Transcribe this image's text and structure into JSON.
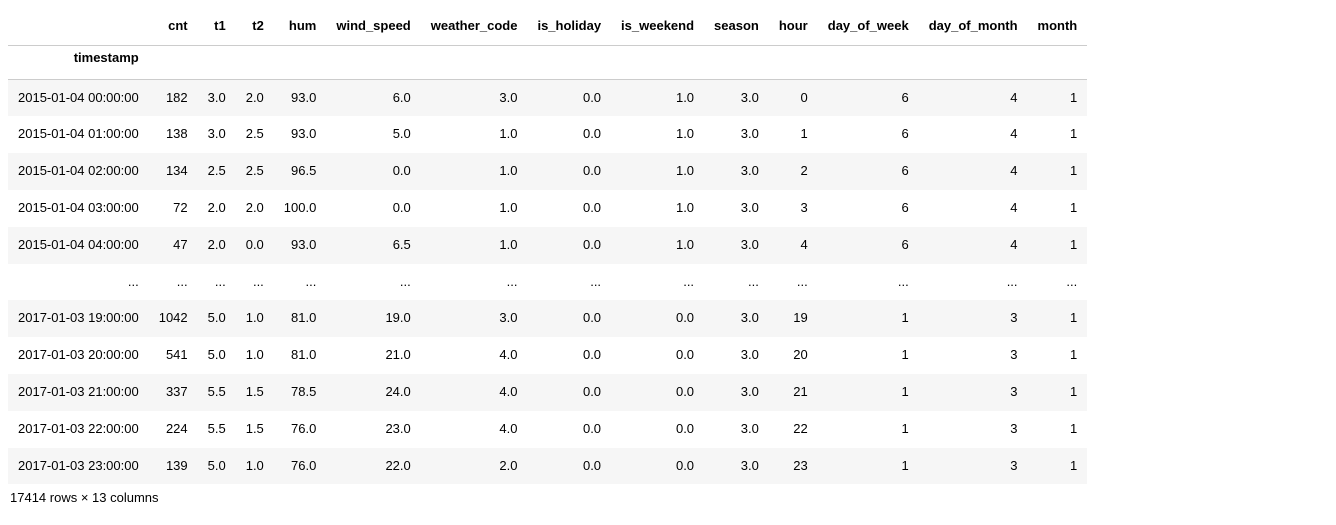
{
  "table": {
    "index_name": "timestamp",
    "columns": [
      "cnt",
      "t1",
      "t2",
      "hum",
      "wind_speed",
      "weather_code",
      "is_holiday",
      "is_weekend",
      "season",
      "hour",
      "day_of_week",
      "day_of_month",
      "month"
    ],
    "rows": [
      {
        "idx": "2015-01-04 00:00:00",
        "cells": [
          "182",
          "3.0",
          "2.0",
          "93.0",
          "6.0",
          "3.0",
          "0.0",
          "1.0",
          "3.0",
          "0",
          "6",
          "4",
          "1"
        ]
      },
      {
        "idx": "2015-01-04 01:00:00",
        "cells": [
          "138",
          "3.0",
          "2.5",
          "93.0",
          "5.0",
          "1.0",
          "0.0",
          "1.0",
          "3.0",
          "1",
          "6",
          "4",
          "1"
        ]
      },
      {
        "idx": "2015-01-04 02:00:00",
        "cells": [
          "134",
          "2.5",
          "2.5",
          "96.5",
          "0.0",
          "1.0",
          "0.0",
          "1.0",
          "3.0",
          "2",
          "6",
          "4",
          "1"
        ]
      },
      {
        "idx": "2015-01-04 03:00:00",
        "cells": [
          "72",
          "2.0",
          "2.0",
          "100.0",
          "0.0",
          "1.0",
          "0.0",
          "1.0",
          "3.0",
          "3",
          "6",
          "4",
          "1"
        ]
      },
      {
        "idx": "2015-01-04 04:00:00",
        "cells": [
          "47",
          "2.0",
          "0.0",
          "93.0",
          "6.5",
          "1.0",
          "0.0",
          "1.0",
          "3.0",
          "4",
          "6",
          "4",
          "1"
        ]
      },
      {
        "idx": "...",
        "cells": [
          "...",
          "...",
          "...",
          "...",
          "...",
          "...",
          "...",
          "...",
          "...",
          "...",
          "...",
          "...",
          "..."
        ],
        "ellipsis": true
      },
      {
        "idx": "2017-01-03 19:00:00",
        "cells": [
          "1042",
          "5.0",
          "1.0",
          "81.0",
          "19.0",
          "3.0",
          "0.0",
          "0.0",
          "3.0",
          "19",
          "1",
          "3",
          "1"
        ]
      },
      {
        "idx": "2017-01-03 20:00:00",
        "cells": [
          "541",
          "5.0",
          "1.0",
          "81.0",
          "21.0",
          "4.0",
          "0.0",
          "0.0",
          "3.0",
          "20",
          "1",
          "3",
          "1"
        ]
      },
      {
        "idx": "2017-01-03 21:00:00",
        "cells": [
          "337",
          "5.5",
          "1.5",
          "78.5",
          "24.0",
          "4.0",
          "0.0",
          "0.0",
          "3.0",
          "21",
          "1",
          "3",
          "1"
        ]
      },
      {
        "idx": "2017-01-03 22:00:00",
        "cells": [
          "224",
          "5.5",
          "1.5",
          "76.0",
          "23.0",
          "4.0",
          "0.0",
          "0.0",
          "3.0",
          "22",
          "1",
          "3",
          "1"
        ]
      },
      {
        "idx": "2017-01-03 23:00:00",
        "cells": [
          "139",
          "5.0",
          "1.0",
          "76.0",
          "22.0",
          "2.0",
          "0.0",
          "0.0",
          "3.0",
          "23",
          "1",
          "3",
          "1"
        ]
      }
    ],
    "summary": "17414 rows × 13 columns"
  }
}
